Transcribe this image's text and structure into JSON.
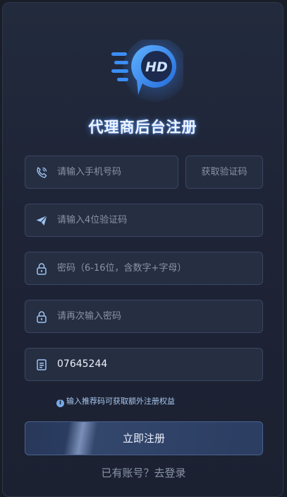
{
  "logo": {
    "letters": "HD"
  },
  "title": "代理商后台注册",
  "fields": {
    "phone": {
      "placeholder": "请输入手机号码",
      "icon": "phone-icon"
    },
    "code_button": "获取验证码",
    "sms_code": {
      "placeholder": "请输入4位验证码",
      "icon": "send-icon"
    },
    "password": {
      "placeholder": "密码（6-16位，含数字+字母）",
      "icon": "lock-icon"
    },
    "password_confirm": {
      "placeholder": "请再次输入密码",
      "icon": "lock-icon"
    },
    "referral": {
      "value": "07645244",
      "icon": "document-icon"
    }
  },
  "hint": {
    "icon": "info-icon",
    "text": "输入推荐码可获取额外注册权益"
  },
  "submit": "立即注册",
  "login_link": "已有账号？去登录",
  "colors": {
    "accent": "#5a96ff",
    "background": "#191d28",
    "input_border": "#3a4660"
  }
}
